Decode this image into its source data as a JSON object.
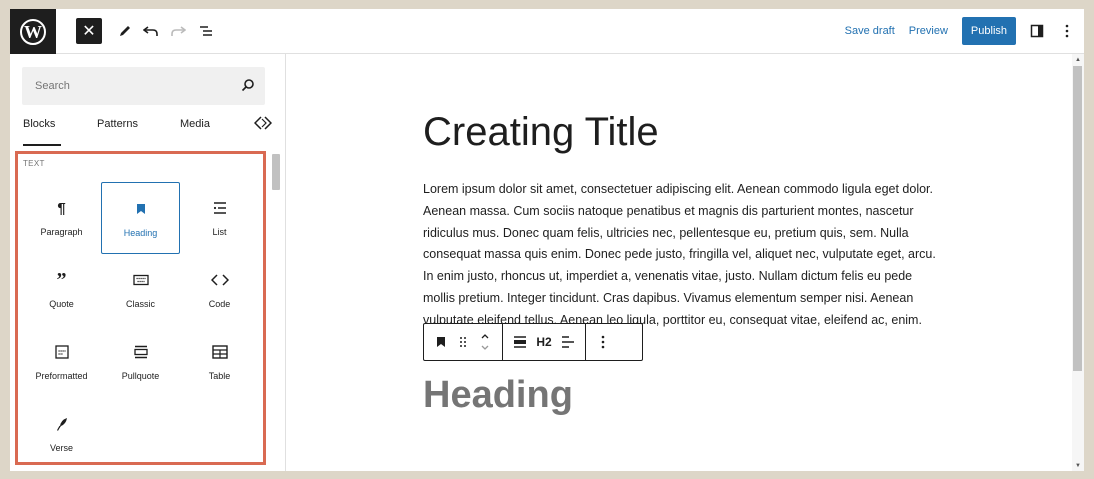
{
  "topbar": {
    "logo_letter": "W",
    "close_symbol": "✕",
    "save_draft": "Save draft",
    "preview": "Preview",
    "publish": "Publish",
    "icons": [
      "wordpress-logo",
      "close-icon",
      "pencil-icon",
      "undo-icon",
      "redo-icon",
      "list-view-icon",
      "sidebar-toggle-icon",
      "more-options-icon"
    ]
  },
  "sidebar": {
    "search_placeholder": "Search",
    "tabs": [
      "Blocks",
      "Patterns",
      "Media"
    ],
    "category": "TEXT",
    "blocks": [
      {
        "label": "Paragraph",
        "icon": "paragraph-icon"
      },
      {
        "label": "Heading",
        "icon": "bookmark-icon",
        "selected": true
      },
      {
        "label": "List",
        "icon": "list-icon"
      },
      {
        "label": "Quote",
        "icon": "quote-icon"
      },
      {
        "label": "Classic",
        "icon": "keyboard-icon"
      },
      {
        "label": "Code",
        "icon": "code-icon"
      },
      {
        "label": "Preformatted",
        "icon": "preformatted-icon"
      },
      {
        "label": "Pullquote",
        "icon": "pullquote-icon"
      },
      {
        "label": "Table",
        "icon": "table-icon"
      },
      {
        "label": "Verse",
        "icon": "feather-icon"
      }
    ],
    "highlight_color": "#d96a52"
  },
  "editor": {
    "title": "Creating Title",
    "paragraph": "Lorem ipsum dolor sit amet, consectetuer adipiscing elit. Aenean commodo ligula eget dolor. Aenean massa. Cum sociis natoque penatibus et magnis dis parturient montes, nascetur ridiculus mus. Donec quam felis, ultricies nec, pellentesque eu, pretium quis, sem. Nulla consequat massa quis enim. Donec pede justo, fringilla vel, aliquet nec, vulputate eget, arcu. In enim justo, rhoncus ut, imperdiet a, venenatis vitae, justo. Nullam dictum felis eu pede mollis pretium. Integer tincidunt. Cras dapibus. Vivamus elementum semper nisi. Aenean vulputate eleifend tellus. Aenean leo ligula, porttitor eu, consequat vitae, eleifend ac, enim.",
    "heading": "Heading",
    "toolbar_h2": "H2"
  },
  "colors": {
    "accent": "#2271b1",
    "dark": "#1e1e1e",
    "heading_gray": "#757575"
  }
}
